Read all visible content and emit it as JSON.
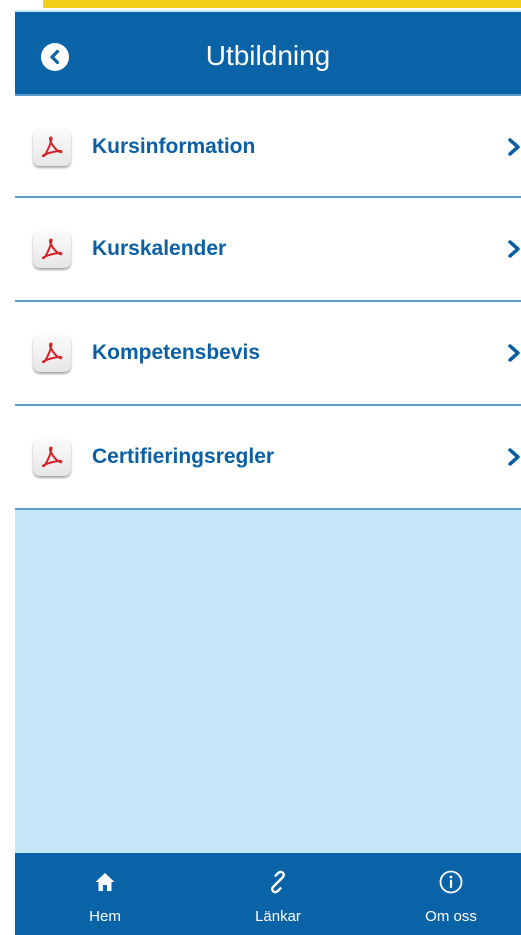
{
  "header": {
    "title": "Utbildning"
  },
  "items": [
    {
      "label": "Kursinformation",
      "icon": "pdf-icon"
    },
    {
      "label": "Kurskalender",
      "icon": "pdf-icon"
    },
    {
      "label": "Kompetensbevis",
      "icon": "pdf-icon"
    },
    {
      "label": "Certifieringsregler",
      "icon": "pdf-icon"
    }
  ],
  "nav": [
    {
      "label": "Hem",
      "icon": "home-icon"
    },
    {
      "label": "Länkar",
      "icon": "link-icon"
    },
    {
      "label": "Om oss",
      "icon": "info-icon"
    }
  ],
  "colors": {
    "header": "#0a63a7",
    "accent_text": "#0b5fa3",
    "background": "#c6e6f8",
    "divider": "#5a9ecf",
    "top_stripe": "#f4cf1a"
  }
}
